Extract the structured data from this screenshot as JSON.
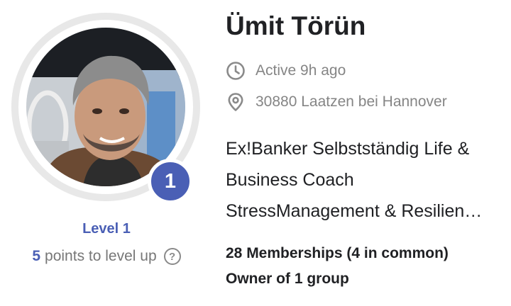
{
  "profile": {
    "name": "Ümit Törün",
    "level_badge": "1",
    "level_label": "Level 1",
    "points_value": "5",
    "points_text": "points to level up",
    "help_icon_glyph": "?",
    "activity": "Active 9h ago",
    "location": "30880 Laatzen bei Hannover",
    "bio_lines": [
      "Ex!Banker Selbstständig Life &",
      "Business Coach",
      "StressManagement & Resilien…"
    ],
    "memberships": "28 Memberships (4 in common)",
    "ownership": "Owner of 1 group"
  },
  "icons": {
    "activity": "clock-icon",
    "location": "map-pin-icon",
    "points_help": "question-circle-icon"
  },
  "colors": {
    "accent": "#4a5fb5",
    "muted_text": "#858585",
    "primary_text": "#202124",
    "ring": "#e8e8e8"
  }
}
